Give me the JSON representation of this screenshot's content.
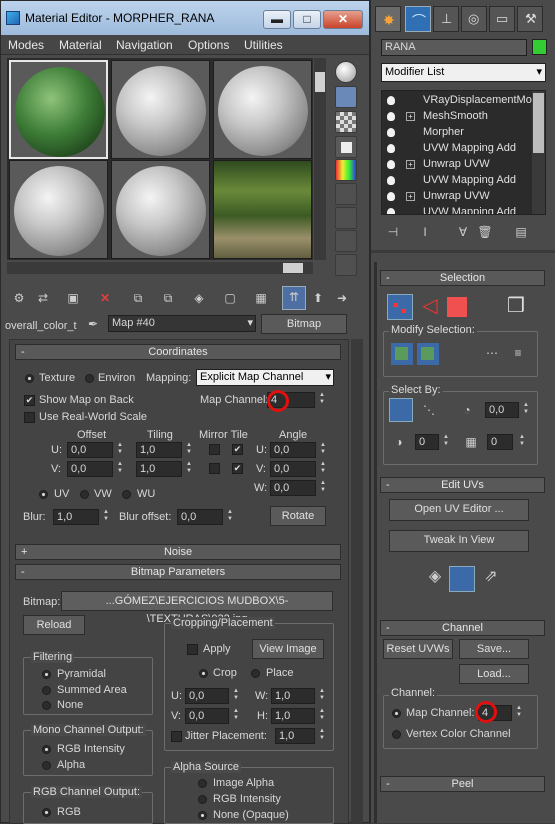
{
  "material_editor": {
    "title": "Material Editor - MORPHER_RANA",
    "menu": [
      "Modes",
      "Material",
      "Navigation",
      "Options",
      "Utilities"
    ],
    "material_name": "overall_color_t",
    "map_name": "Map #40",
    "map_type": "Bitmap",
    "coordinates": {
      "header": "Coordinates",
      "texture_label": "Texture",
      "environ_label": "Environ",
      "mapping_label": "Mapping:",
      "mapping_value": "Explicit Map Channel",
      "show_map_on_back": "Show Map on Back",
      "map_channel_label": "Map Channel:",
      "map_channel_value": "4",
      "use_real_world": "Use Real-World Scale",
      "offset_header": "Offset",
      "tiling_header": "Tiling",
      "mirror_tile_header": "Mirror Tile",
      "angle_header": "Angle",
      "u_label": "U:",
      "v_label": "V:",
      "w_label": "W:",
      "u_offset": "0,0",
      "v_offset": "0,0",
      "u_tiling": "1,0",
      "v_tiling": "1,0",
      "u_angle": "0,0",
      "v_angle": "0,0",
      "w_angle": "0,0",
      "uv": "UV",
      "vw": "VW",
      "wu": "WU",
      "blur_label": "Blur:",
      "blur_value": "1,0",
      "blur_offset_label": "Blur offset:",
      "blur_offset_value": "0,0",
      "rotate_button": "Rotate"
    },
    "noise_header": "Noise",
    "bitmap_params": {
      "header": "Bitmap Parameters",
      "bitmap_label": "Bitmap:",
      "bitmap_path": "...GÓMEZ\\EJERCICIOS MUDBOX\\5-\\TEXTURAS\\022.jpg",
      "reload": "Reload",
      "cropping_header": "Cropping/Placement",
      "apply": "Apply",
      "view_image": "View Image",
      "crop": "Crop",
      "place": "Place",
      "u_label": "U:",
      "v_label": "V:",
      "w_label": "W:",
      "h_label": "H:",
      "u_value": "0,0",
      "v_value": "0,0",
      "w_value": "1,0",
      "h_value": "1,0",
      "jitter": "Jitter Placement:",
      "jitter_value": "1,0",
      "filtering_header": "Filtering",
      "pyramidal": "Pyramidal",
      "summed_area": "Summed Area",
      "none": "None",
      "mono_header": "Mono Channel Output:",
      "rgb_intensity": "RGB Intensity",
      "alpha": "Alpha",
      "rgb_header": "RGB Channel Output:",
      "rgb": "RGB",
      "alpha_source_header": "Alpha Source",
      "image_alpha": "Image Alpha",
      "rgb_intensity2": "RGB Intensity",
      "none_opaque": "None (Opaque)"
    }
  },
  "command_panel": {
    "object_name": "RANA",
    "object_color": "#33cc33",
    "modifier_list": "Modifier List",
    "stack": [
      {
        "label": "VRayDisplacementMo",
        "plus": false
      },
      {
        "label": "MeshSmooth",
        "plus": true
      },
      {
        "label": "Morpher",
        "plus": false
      },
      {
        "label": "UVW Mapping Add",
        "plus": false
      },
      {
        "label": "Unwrap UVW",
        "plus": true
      },
      {
        "label": "UVW Mapping Add",
        "plus": false
      },
      {
        "label": "Unwrap UVW",
        "plus": true
      },
      {
        "label": "UVW Mapping Add",
        "plus": false
      }
    ],
    "selection_header": "Selection",
    "modify_selection": "Modify Selection:",
    "select_by": "Select By:",
    "select_by_value1": "0,0",
    "select_by_value2": "0",
    "select_by_value3": "0",
    "edit_uvs_header": "Edit UVs",
    "open_uv_editor": "Open UV Editor ...",
    "tweak_in_view": "Tweak In View",
    "channel_header": "Channel",
    "reset_uvws": "Reset UVWs",
    "save": "Save...",
    "load": "Load...",
    "channel_label": "Channel:",
    "map_channel_label": "Map Channel:",
    "map_channel_value": "4",
    "vertex_color_channel": "Vertex Color Channel",
    "peel_header": "Peel"
  }
}
